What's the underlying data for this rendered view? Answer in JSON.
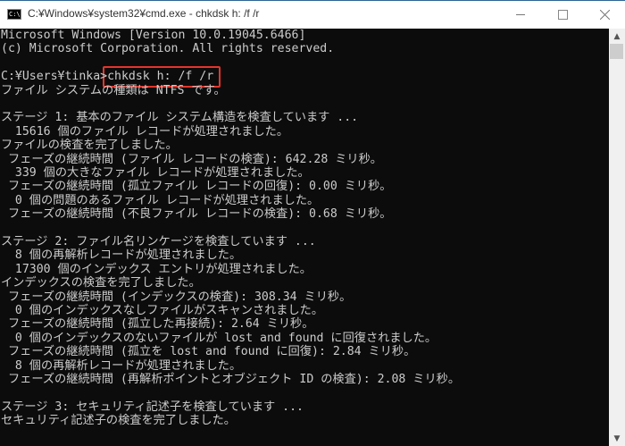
{
  "window": {
    "title": "C:¥Windows¥system32¥cmd.exe - chkdsk  h: /f /r",
    "icon_label": "C:\\.",
    "controls": [
      "minimize-icon",
      "maximize-icon",
      "close-icon"
    ]
  },
  "console": {
    "lines": [
      "Microsoft Windows [Version 10.0.19045.6466]",
      "(c) Microsoft Corporation. All rights reserved.",
      "",
      "C:¥Users¥tinka>chkdsk h: /f /r",
      "ファイル システムの種類は NTFS です。",
      "",
      "ステージ 1: 基本のファイル システム構造を検査しています ...",
      "  15616 個のファイル レコードが処理されました。",
      "ファイルの検査を完了しました。",
      " フェーズの継続時間 (ファイル レコードの検査): 642.28 ミリ秒。",
      "  339 個の大きなファイル レコードが処理されました。",
      " フェーズの継続時間 (孤立ファイル レコードの回復): 0.00 ミリ秒。",
      "  0 個の問題のあるファイル レコードが処理されました。",
      " フェーズの継続時間 (不良ファイル レコードの検査): 0.68 ミリ秒。",
      "",
      "ステージ 2: ファイル名リンケージを検査しています ...",
      "  8 個の再解析レコードが処理されました。",
      "  17300 個のインデックス エントリが処理されました。",
      "インデックスの検査を完了しました。",
      " フェーズの継続時間 (インデックスの検査): 308.34 ミリ秒。",
      "  0 個のインデックスなしファイルがスキャンされました。",
      " フェーズの継続時間 (孤立した再接続): 2.64 ミリ秒。",
      "  0 個のインデックスのないファイルが lost and found に回復されました。",
      " フェーズの継続時間 (孤立を lost and found に回復): 2.84 ミリ秒。",
      "  8 個の再解析レコードが処理されました。",
      " フェーズの継続時間 (再解析ポイントとオブジェクト ID の検査): 2.08 ミリ秒。",
      "",
      "ステージ 3: セキュリティ記述子を検査しています ...",
      "セキュリティ記述子の検査を完了しました。"
    ],
    "highlight_color": "#e5352b",
    "text_color": "#cccccc",
    "background": "#0c0c0c"
  }
}
